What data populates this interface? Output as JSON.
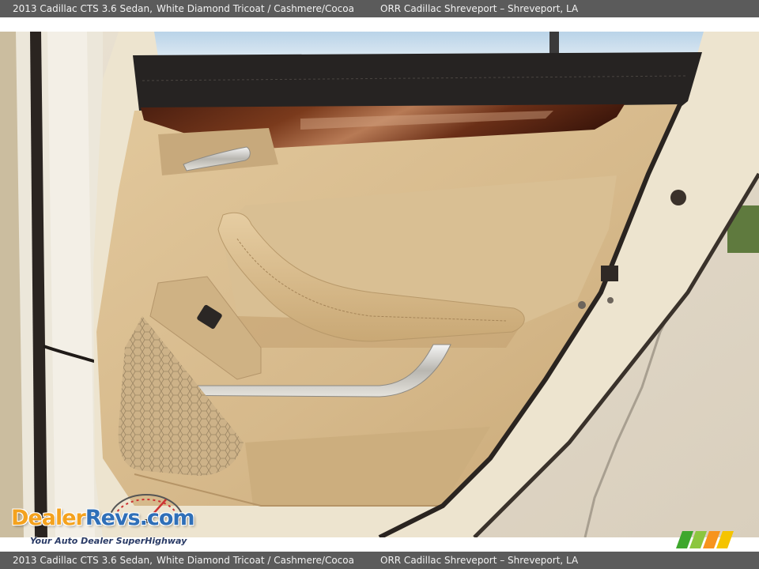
{
  "caption": {
    "vehicle": "2013 Cadillac CTS 3.6 Sedan,",
    "colors": "White Diamond Tricoat / Cashmere/Cocoa",
    "dealer": "ORR Cadillac Shreveport – Shreveport, LA"
  },
  "watermark": {
    "brand_left": "Dealer",
    "brand_right": "Revs",
    "brand_suffix": ".com",
    "tagline": "Your Auto Dealer SuperHighway"
  },
  "colors": {
    "bar_bg": "#5b5b5b",
    "leather": "#d9bd92",
    "wood": "#5e2a16",
    "door_paint": "#ece2cc"
  },
  "icons": {
    "gauge": "speedometer-icon",
    "corner_logo": "mm-stripes-icon"
  }
}
